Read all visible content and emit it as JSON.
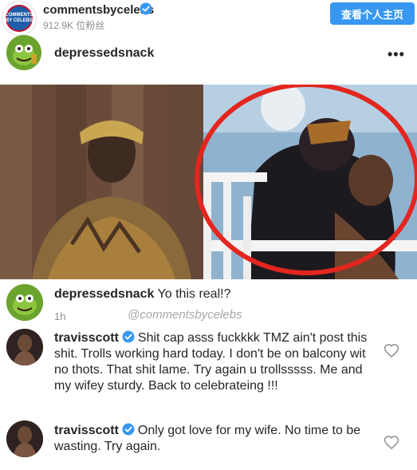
{
  "header": {
    "account_name": "commentsbycelebs",
    "followers_text": "912.9K 位粉丝",
    "view_profile_label": "查看个人主页",
    "badge_text": "COMMENTS BY CELEBS",
    "accent_color": "#3897f0"
  },
  "post": {
    "username": "depressedsnack",
    "more_icon": "more-options-icon"
  },
  "comments": [
    {
      "username": "depressedsnack",
      "text": "Yo this real!?",
      "time": "1h"
    },
    {
      "username": "travisscott",
      "verified": true,
      "text": "Shit cap asss fuckkkk TMZ ain't post this shit. Trolls working hard today. I don't be on balcony wit no thots. That shit lame. Try again u trollsssss. Me and my wifey sturdy. Back to celebrateing !!!"
    },
    {
      "username": "travisscott",
      "verified": true,
      "text": "Only got love for my wife. No time to be wasting. Try again."
    }
  ],
  "watermark": "@commentsbycelebs"
}
